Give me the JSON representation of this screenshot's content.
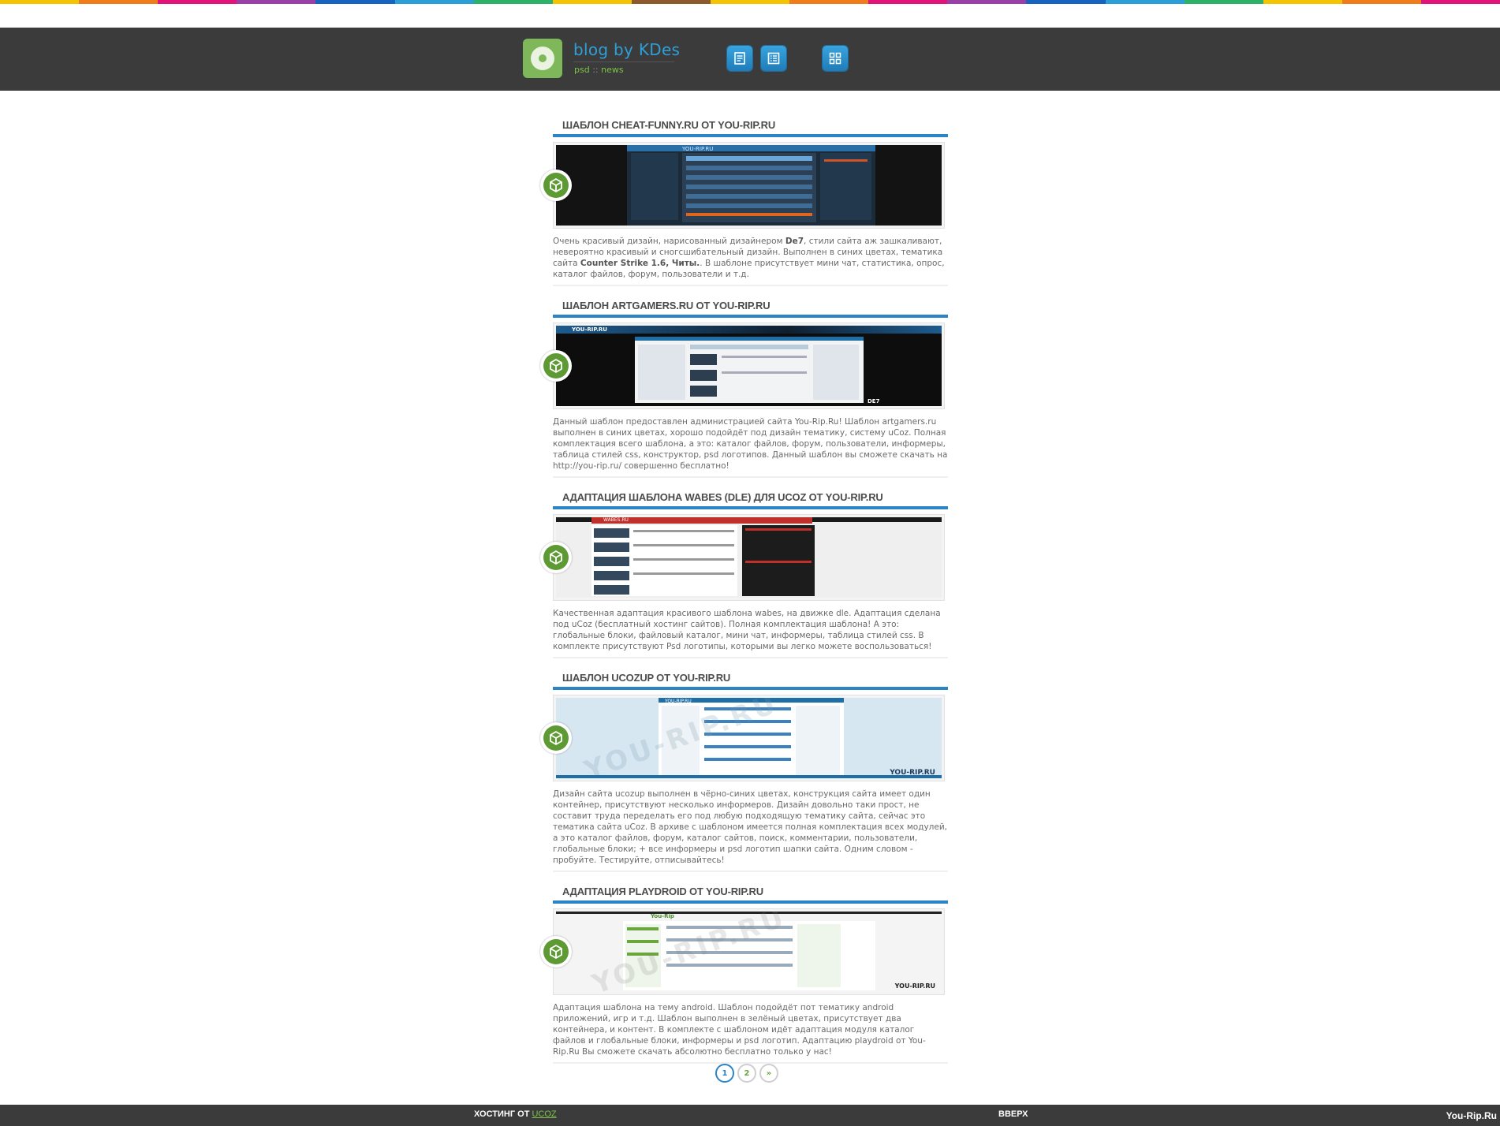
{
  "colors": {
    "rainbow": [
      "#f5c400",
      "#f07c1a",
      "#e2137a",
      "#9b3fa8",
      "#1565c0",
      "#2a9fd8",
      "#2db26a",
      "#f5c400",
      "#8d5a2b",
      "#f5c400",
      "#f07c1a",
      "#e2137a",
      "#9b3fa8",
      "#1565c0",
      "#2a9fd8",
      "#2db26a",
      "#f5c400",
      "#f07c1a",
      "#e2137a"
    ],
    "accent_blue": "#2a84c6",
    "accent_green": "#7fb85a",
    "header_bg": "#3b3b3b"
  },
  "header": {
    "title": "blog by KDes",
    "sub_left": "psd",
    "sub_sep": "::",
    "sub_right": "news",
    "buttons": [
      {
        "name": "posts-icon"
      },
      {
        "name": "list-icon"
      },
      {
        "name": "grid-icon"
      }
    ]
  },
  "posts": [
    {
      "title": "Шаблон cheat-funny.ru от You-Rip.Ru",
      "desc_parts": [
        "Очень красивый дизайн, нарисованный дизайнером ",
        "De7",
        ", стили сайта аж зашкаливают, невероятно красивый и сногсшибательный дизайн. Выполнен в синих цветах, тематика сайта ",
        "Counter Strike 1.6, Читы.",
        ". В шаблоне присутствует мини чат, статистика, опрос, каталог файлов, форум, пользователи и т.д."
      ]
    },
    {
      "title": "Шаблон artgamers.ru от You-Rip.Ru",
      "desc": "Данный шаблон предоставлен администрацией сайта You-Rip.Ru! Шаблон artgamers.ru выполнен в синих цветах, хорошо подойдёт под дизайн тематику, систему uCoz. Полная комплектация всего шаблона, а это: каталог файлов, форум, пользователи, информеры, таблица стилей css, конструктор, psd логотипов. Данный шаблон вы сможете скачать на http://you-rip.ru/ совершенно бесплатно!"
    },
    {
      "title": "Адаптация шаблона wabes (DLE) для uCoz от You-Rip.Ru",
      "desc": "Качественная адаптация красивого шаблона wabes, на движке dle. Адаптация сделана под uCoz (бесплатный хостинг сайтов). Полная комплектация шаблона! А это: глобальные блоки, файловый каталог, мини чат, информеры, таблица стилей css. В комплекте присутствуют Psd логотипы, которыми вы легко можете воспользоваться!"
    },
    {
      "title": "Шаблон ucozup от You-Rip.Ru",
      "desc": "Дизайн сайта ucozup выполнен в чёрно-синих цветах, конструкция сайта имеет один контейнер, присутствуют несколько информеров. Дизайн довольно таки прост, не составит труда переделать его под любую подходящую тематику сайта, сейчас это тематика сайта uCoz. В архиве с шаблоном имеется полная комплектация всех модулей, а это каталог файлов, форум, каталог сайтов, поиск, комментарии, пользователи, глобальные блоки; + все информеры и psd логотип шапки сайта. Одним словом - пробуйте. Тестируйте, отписывайтесь!"
    },
    {
      "title": "Адаптация playdroid от You-Rip.Ru",
      "desc": "Адаптация шаблона на тему android. Шаблон подойдёт пот тематику android приложений, игр и т.д. Шаблон выполнен в зелёный цветах, присутствует два контейнера, и контент. В комплекте с шаблоном идёт адаптация модуля каталог файлов и глобальные блоки, информеры и psd логотип. Адаптацию playdroid от You-Rip.Ru Вы сможете скачать абсолютно бесплатно только у нас!"
    }
  ],
  "thumb_texts": {
    "t1": "YOU-RIP.RU",
    "t2": "YOU-RIP.RU",
    "t2b": "DE7",
    "t3": "WABES.RU",
    "t4": "YOU-RIP.RU",
    "t4b": "YOU-RIP.RU",
    "t5": "You-Rip",
    "t5b": "YOU-RIP.RU"
  },
  "pager": {
    "page1": "1",
    "page2": "2",
    "next": "»"
  },
  "footer": {
    "hosting_label": "ХОСТИНГ ОТ ",
    "hosting_link": "UCOZ",
    "top_link": "ВВЕРХ",
    "watermark": "You-Rip.Ru"
  }
}
